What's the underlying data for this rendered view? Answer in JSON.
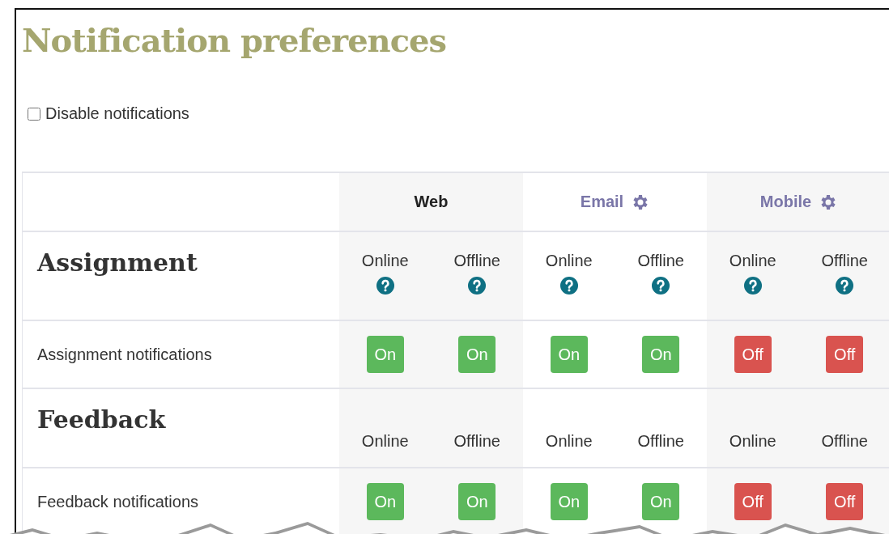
{
  "title": "Notification preferences",
  "disable_notifications": {
    "label": "Disable notifications",
    "checked": false
  },
  "columns": [
    {
      "label": "Web",
      "kind": "plain"
    },
    {
      "label": "Email",
      "kind": "link"
    },
    {
      "label": "Mobile",
      "kind": "link"
    }
  ],
  "sections": [
    {
      "heading": "Assignment",
      "states": [
        {
          "label": "Online",
          "help": true
        },
        {
          "label": "Offline",
          "help": true
        },
        {
          "label": "Online",
          "help": true
        },
        {
          "label": "Offline",
          "help": true
        },
        {
          "label": "Online",
          "help": true
        },
        {
          "label": "Offline",
          "help": true
        }
      ],
      "rows": [
        {
          "label": "Assignment notifications",
          "toggles": [
            {
              "label": "On",
              "on": true
            },
            {
              "label": "On",
              "on": true
            },
            {
              "label": "On",
              "on": true
            },
            {
              "label": "On",
              "on": true
            },
            {
              "label": "Off",
              "on": false
            },
            {
              "label": "Off",
              "on": false
            }
          ]
        }
      ]
    },
    {
      "heading": "Feedback",
      "states": [
        {
          "label": "Online",
          "help": false
        },
        {
          "label": "Offline",
          "help": false
        },
        {
          "label": "Online",
          "help": false
        },
        {
          "label": "Offline",
          "help": false
        },
        {
          "label": "Online",
          "help": false
        },
        {
          "label": "Offline",
          "help": false
        }
      ],
      "rows": [
        {
          "label": "Feedback notifications",
          "toggles": [
            {
              "label": "On",
              "on": true
            },
            {
              "label": "On",
              "on": true
            },
            {
              "label": "On",
              "on": true
            },
            {
              "label": "On",
              "on": true
            },
            {
              "label": "Off",
              "on": false
            },
            {
              "label": "Off",
              "on": false
            }
          ]
        }
      ]
    }
  ]
}
